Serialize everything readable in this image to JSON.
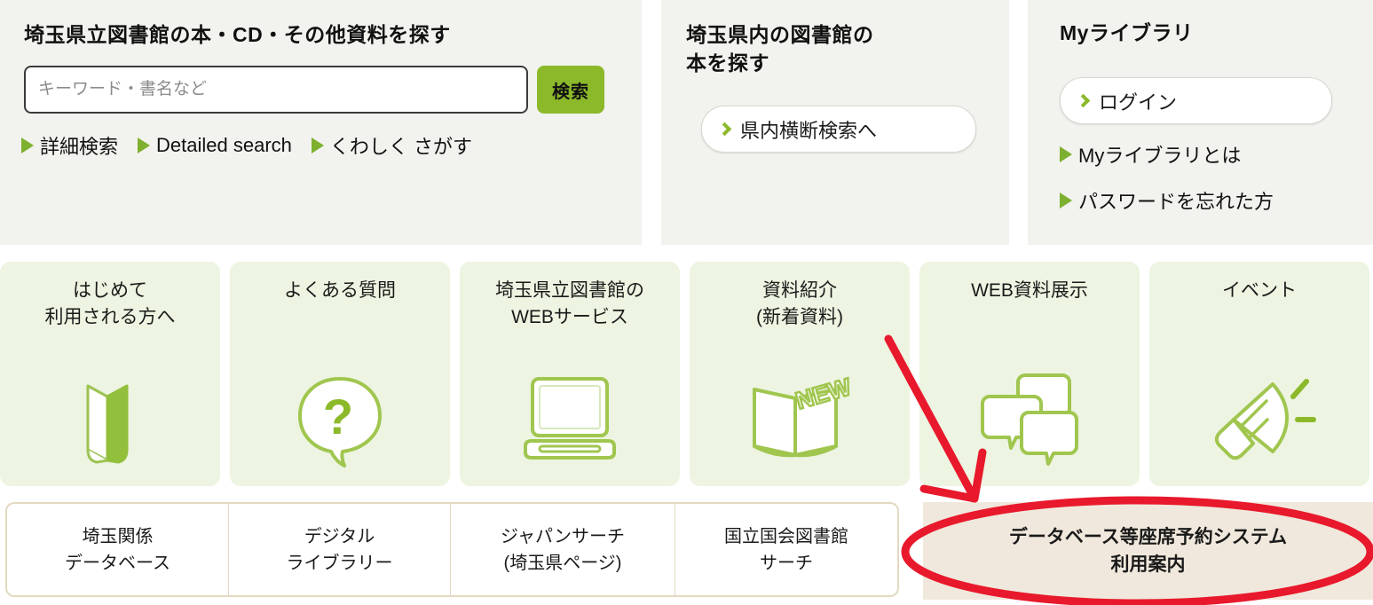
{
  "search_panel": {
    "title": "埼玉県立図書館の本・CD・その他資料を探す",
    "input_placeholder": "キーワード・書名など",
    "input_value": "",
    "search_button": "検索",
    "links": [
      {
        "label": "詳細検索",
        "icon": "triangle-right-icon"
      },
      {
        "label": "Detailed search",
        "icon": "triangle-right-icon"
      },
      {
        "label": "くわしく さがす",
        "icon": "triangle-right-icon"
      }
    ]
  },
  "prefecture_panel": {
    "title": "埼玉県内の図書館の\n本を探す",
    "button": {
      "label": "県内横断検索へ",
      "icon": "chevron-right-icon"
    }
  },
  "mylibrary_panel": {
    "title": "Myライブラリ",
    "login_button": {
      "label": "ログイン",
      "icon": "chevron-right-icon"
    },
    "links": [
      {
        "label": "Myライブラリとは",
        "icon": "triangle-right-icon"
      },
      {
        "label": "パスワードを忘れた方",
        "icon": "triangle-right-icon"
      }
    ]
  },
  "cards": [
    {
      "label": "はじめて\n利用される方へ",
      "icon": "open-book-bookmark-icon"
    },
    {
      "label": "よくある質問",
      "icon": "question-speech-bubble-icon"
    },
    {
      "label": "埼玉県立図書館の\nWEBサービス",
      "icon": "laptop-icon"
    },
    {
      "label": "資料紹介\n(新着資料)",
      "icon": "open-book-new-badge-icon"
    },
    {
      "label": "WEB資料展示",
      "icon": "chat-bubbles-icon"
    },
    {
      "label": "イベント",
      "icon": "megaphone-icon"
    }
  ],
  "bottom_links": [
    {
      "label": "埼玉関係\nデータベース"
    },
    {
      "label": "デジタル\nライブラリー"
    },
    {
      "label": "ジャパンサーチ\n(埼玉県ページ)"
    },
    {
      "label": "国立国会図書館\nサーチ"
    },
    {
      "label": "データベース等座席予約システム\n利用案内",
      "highlighted": true
    }
  ],
  "annotation": {
    "type": "red-arrow-and-ellipse",
    "color": "#E8192C",
    "target": "データベース等座席予約システム 利用案内"
  },
  "colors": {
    "panel_bg": "#F2F2EE",
    "card_bg": "#EDF4E1",
    "accent_green": "#8CB92A",
    "icon_green": "#A0C64F",
    "bottom_border": "#E3D9C0",
    "highlight_bg": "#F0E8DC",
    "annotation_red": "#E8192C"
  }
}
